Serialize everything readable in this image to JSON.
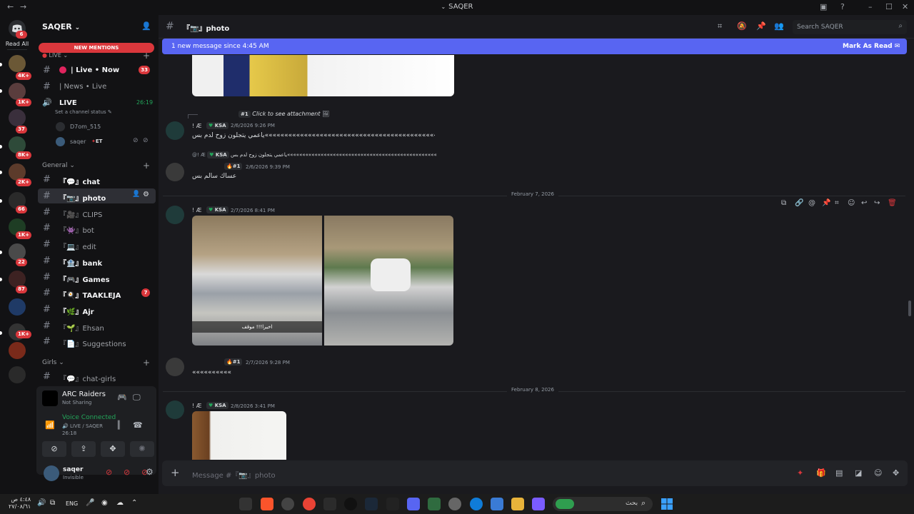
{
  "window": {
    "title": "SAQER",
    "back_icon": "arrow-left-icon",
    "forward_icon": "arrow-right-icon"
  },
  "rail": {
    "read_all": "Read All",
    "badges": [
      "6",
      "4K+",
      "1K+",
      "37",
      "8K+",
      "2K+",
      "66",
      "1K+",
      "22",
      "87",
      "1K+"
    ]
  },
  "sidebar": {
    "server_name": "SAQER",
    "new_mentions": "NEW MENTIONS",
    "live_category": "LIVE",
    "channels_top": [
      {
        "label": "| Live • Now",
        "badge": "33",
        "bold": true
      },
      {
        "label": "| News • Live",
        "badge": "",
        "bold": false
      }
    ],
    "voice_channel": {
      "label": "LIVE",
      "timer": "26:19",
      "status": "Set a channel status"
    },
    "voice_users": [
      {
        "name": "D7om_515"
      },
      {
        "name": "saqer",
        "tag": "ET"
      }
    ],
    "general_category": "General",
    "channels": [
      {
        "label": "『💬』chat",
        "bold": true,
        "badge": ""
      },
      {
        "label": "『📷』photo",
        "bold": true,
        "badge": "",
        "active": true
      },
      {
        "label": "『🎥』CLIPS",
        "bold": false,
        "badge": ""
      },
      {
        "label": "『👾』bot",
        "bold": false,
        "badge": ""
      },
      {
        "label": "『💻』edit",
        "bold": false,
        "badge": ""
      },
      {
        "label": "『🏦』bank",
        "bold": true,
        "badge": ""
      },
      {
        "label": "『🎮』Games",
        "bold": true,
        "badge": ""
      },
      {
        "label": "『🍳』TAAKLEJA",
        "bold": true,
        "badge": "7"
      },
      {
        "label": "『🌿』Ajr",
        "bold": true,
        "badge": ""
      },
      {
        "label": "『🌱』Ehsan",
        "bold": false,
        "badge": ""
      },
      {
        "label": "『📄』Suggestions",
        "bold": false,
        "badge": ""
      }
    ],
    "girls_category": "Girls",
    "girls_channels": [
      {
        "label": "『💬』chat-girls"
      }
    ],
    "activity": {
      "game": "ARC Raiders",
      "status": "Not Sharing"
    },
    "voice": {
      "status": "Voice Connected",
      "channel": "LIVE / SAQER",
      "timer": "26:18"
    },
    "user": {
      "name": "saqer",
      "status": "Invisible"
    }
  },
  "main": {
    "channel_title": "『📷』photo",
    "search_placeholder": "Search SAQER",
    "new_messages": "1 new message since 4:45 AM",
    "mark_as_read": "Mark As Read",
    "messages": [
      {
        "reply_prefix": "#1",
        "reply_text": "Click to see attachment",
        "author": "! Æ",
        "tag": "KSA",
        "time": "2/6/2026 9:26 PM",
        "text": "ياعمي يتجلون زوح لدم بس«««««««««««««««««««««««««««««««««««««««««««««"
      },
      {
        "reply_prefix": "@! Æ",
        "reply_tag": "KSA",
        "reply_text": "ياعمي يتجلون زوح لدم بس«««««««««««««««««««««««««««««««««««««««««««««««««",
        "author_badge": "#1",
        "time": "2/6/2026 9:39 PM",
        "text": "عساك سالم بس"
      },
      {
        "divider": "February 7, 2026",
        "author": "! Æ",
        "tag": "KSA",
        "time": "2/7/2026 8:41 PM",
        "image_caption": "اخيرا!!! موقف"
      },
      {
        "author_badge": "#1",
        "time": "2/7/2026 9:28 PM",
        "text": "««««««««««"
      },
      {
        "divider": "February 8, 2026",
        "author": "! Æ",
        "tag": "KSA",
        "time": "2/8/2026 3:41 PM"
      }
    ],
    "composer_placeholder": "Message #『📷』photo"
  },
  "taskbar": {
    "time": "٤:٤٨ ص",
    "date": "٢٧/٠٨/٦١",
    "language": "ENG",
    "search_placeholder": "بحث"
  }
}
